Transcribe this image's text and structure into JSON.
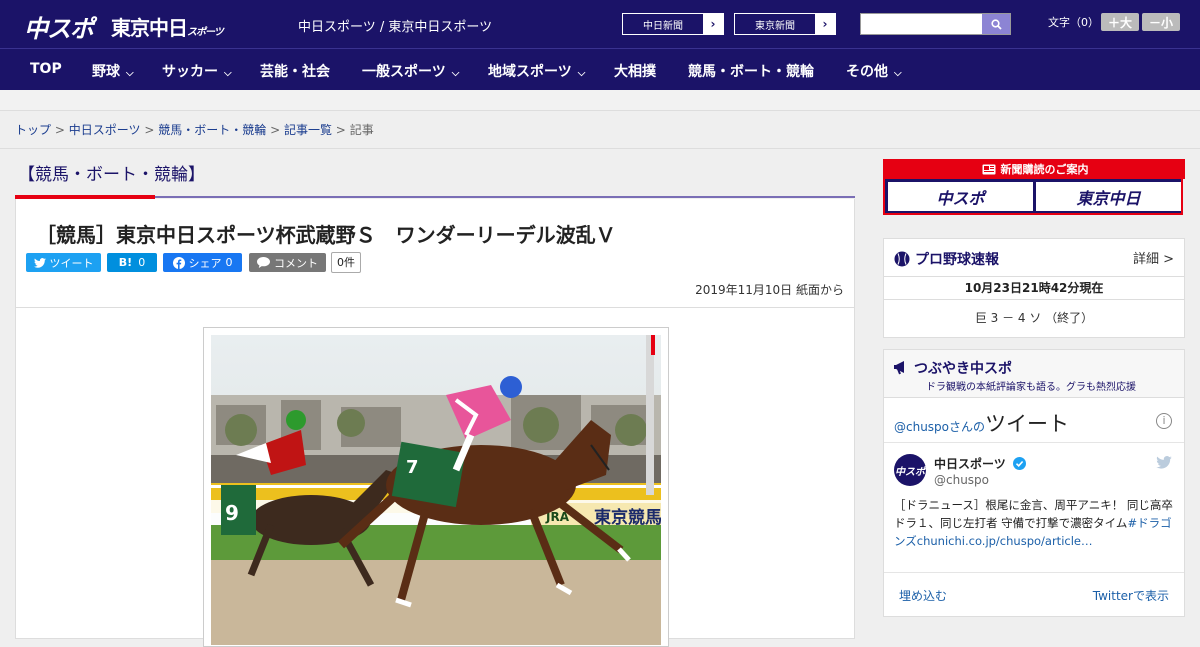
{
  "header": {
    "logo_main": "中スポ",
    "logo_sub": "東京中日",
    "logo_sub_small": "スポーツ",
    "site_name": "中日スポーツ / 東京中日スポーツ",
    "ext_links": [
      "中日新聞",
      "東京新聞"
    ],
    "search_placeholder": "",
    "font_size_label": "文字（0）",
    "font_bigger": "＋大",
    "font_smaller": "－小"
  },
  "nav": {
    "items": [
      {
        "label": "TOP"
      },
      {
        "label": "野球"
      },
      {
        "label": "サッカー"
      },
      {
        "label": "芸能・社会"
      },
      {
        "label": "一般スポーツ"
      },
      {
        "label": "地域スポーツ"
      },
      {
        "label": "大相撲"
      },
      {
        "label": "競馬・ボート・競輪"
      },
      {
        "label": "その他"
      }
    ]
  },
  "breadcrumb": {
    "items": [
      "トップ",
      "中日スポーツ",
      "競馬・ボート・競輪",
      "記事一覧"
    ],
    "current": "記事",
    "separator": ">"
  },
  "category_title": "【競馬・ボート・競輪】",
  "article": {
    "headline": "［競馬］東京中日スポーツ杯武蔵野Ｓ　ワンダーリーデル波乱Ｖ",
    "share": {
      "tweet": "ツイート",
      "hatena": "B!",
      "hatena_count": "0",
      "facebook": "シェア",
      "facebook_count": "0",
      "comment": "コメント",
      "comment_count": "0件"
    },
    "date": "2019年11月10日 紙面から",
    "photo_texts": {
      "rail_sign": "東京競馬",
      "jra": "JRA",
      "saddle_7": "7",
      "saddle_9": "9"
    }
  },
  "sidebar": {
    "subscribe": {
      "title": "新聞購読のご案内",
      "btn1": "中スポ",
      "btn2": "東京中日"
    },
    "baseball": {
      "title": "プロ野球速報",
      "detail": "詳細 >",
      "timestamp": "10月23日21時42分現在",
      "score": "巨 3 － 4 ソ （終了）"
    },
    "twitter": {
      "title": "つぶやき中スポ",
      "subtitle": "ドラ観戦の本紙評論家も語る。グラも熱烈応援",
      "who_handle": "@chuspo",
      "who_suffix": "さんの",
      "who_big": "ツイート",
      "info": "i",
      "name": "中日スポーツ",
      "handle": "@chuspo",
      "avatar_text": "中スポ",
      "text": "［ドラニュース］根尾に金言、周平アニキ！ 同じ高卒ドラ１、同じ左打者 守備で打撃で濃密タイム",
      "text_tag": "#ドラゴンズ",
      "text_link": "chunichi.co.jp/chuspo/article…",
      "embed": "埋め込む",
      "view": "Twitterで表示"
    }
  },
  "colors": {
    "brand": "#1b1368",
    "accent_red": "#e60012",
    "twitter": "#1da1f2",
    "hatena": "#008fde",
    "facebook": "#1877f2",
    "comment": "#777777"
  }
}
